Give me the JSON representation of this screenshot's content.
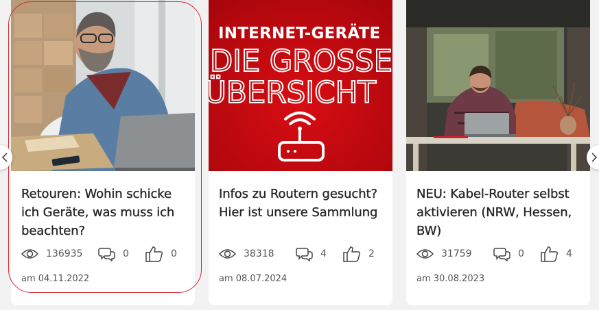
{
  "cards": [
    {
      "title": "Retouren: Wohin schicke ich Geräte, was muss ich beachten?",
      "views": "136935",
      "comments": "0",
      "likes": "0",
      "date": "am 04.11.2022",
      "image": "man-with-laptop-and-parcels"
    },
    {
      "title": "Infos zu Routern gesucht? Hier ist unsere Sammlung",
      "views": "38318",
      "comments": "4",
      "likes": "2",
      "date": "am 08.07.2024",
      "image": "router-overview-banner",
      "banner": {
        "line1": "INTERNET-GERÄTE",
        "line2": "DIE GROSSE",
        "line3": "ÜBERSICHT"
      }
    },
    {
      "title": "NEU: Kabel-Router selbst aktivieren (NRW, Hessen, BW)",
      "views": "31759",
      "comments": "0",
      "likes": "4",
      "date": "am 30.08.2023",
      "image": "man-at-table-with-laptop"
    }
  ],
  "icons": {
    "views": "eye-icon",
    "comments": "speech-bubbles-icon",
    "likes": "thumbs-up-icon",
    "prev": "chevron-left-icon",
    "next": "chevron-right-icon"
  },
  "colors": {
    "brand_red": "#e60000",
    "highlight": "#d52b33",
    "text": "#262626",
    "meta": "#555555",
    "background": "#f2f2f2"
  }
}
